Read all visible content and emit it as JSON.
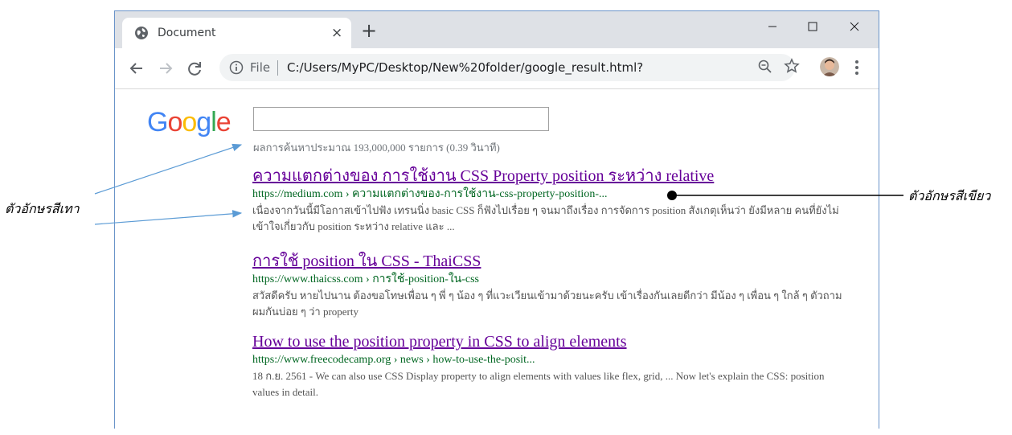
{
  "browser": {
    "tab_title": "Document",
    "tab_close": "×",
    "new_tab": "+",
    "url_scheme": "File",
    "url": "C:/Users/MyPC/Desktop/New%20folder/google_result.html?",
    "icons": [
      "globe-icon",
      "close-icon",
      "plus-icon",
      "minimize-icon",
      "maximize-icon",
      "window-close-icon",
      "back-arrow-icon",
      "forward-arrow-icon",
      "reload-icon",
      "info-icon",
      "zoom-out-icon",
      "star-icon",
      "avatar",
      "more-vert-icon"
    ]
  },
  "page": {
    "logo": {
      "letters": [
        "G",
        "o",
        "o",
        "g",
        "l",
        "e"
      ],
      "colors": [
        "#4285F4",
        "#EA4335",
        "#FBBC05",
        "#4285F4",
        "#34A853",
        "#EA4335"
      ]
    },
    "search_value": "",
    "stats": "ผลการค้นหาประมาณ 193,000,000 รายการ (0.39 วินาที)",
    "results": [
      {
        "title": "ความแตกต่างของ การใช้งาน CSS Property position ระหว่าง relative",
        "url": "https://medium.com › ความแตกต่างของ-การใช้งาน-css-property-position-...",
        "snippet": "เนื่องจากวันนี้มีโอกาสเข้าไปฟัง เทรนนิ่ง basic CSS ก็ฟังไปเรื่อย ๆ จนมาถึงเรื่อง การจัดการ position สังเกตุเห็นว่า ยังมีหลาย คนที่ยังไม่เข้าใจเกี่ยวกับ position ระหว่าง relative และ ..."
      },
      {
        "title": "การใช้ position ใน CSS - ThaiCSS",
        "url": "https://www.thaicss.com › การใช้-position-ใน-css",
        "snippet": "สวัสดีครับ หายไปนาน ต้องขอโทษเพื่อน ๆ พี่ ๆ น้อง ๆ ที่แวะเวียนเข้ามาด้วยนะครับ เข้าเรื่องกันเลยดีกว่า มีน้อง ๆ เพื่อน ๆ ใกล้ ๆ ตัวถามผมกันบ่อย ๆ ว่า property"
      },
      {
        "title": "How to use the position property in CSS to align elements",
        "url": "https://www.freecodecamp.org › news › how-to-use-the-posit...",
        "snippet": "18 ก.ย. 2561 - We can also use CSS Display property to align elements with values like flex, grid, ... Now let's explain the CSS: position values in detail."
      }
    ]
  },
  "annotations": {
    "gray_label": "ตัวอักษรสีเทา",
    "green_label": "ตัวอักษรสีเขียว"
  },
  "colors": {
    "title_visited": "#660099",
    "url_green": "#006621",
    "snippet_gray": "#545454",
    "arrow_blue": "#5b9bd5",
    "window_border": "#6a94c9"
  }
}
